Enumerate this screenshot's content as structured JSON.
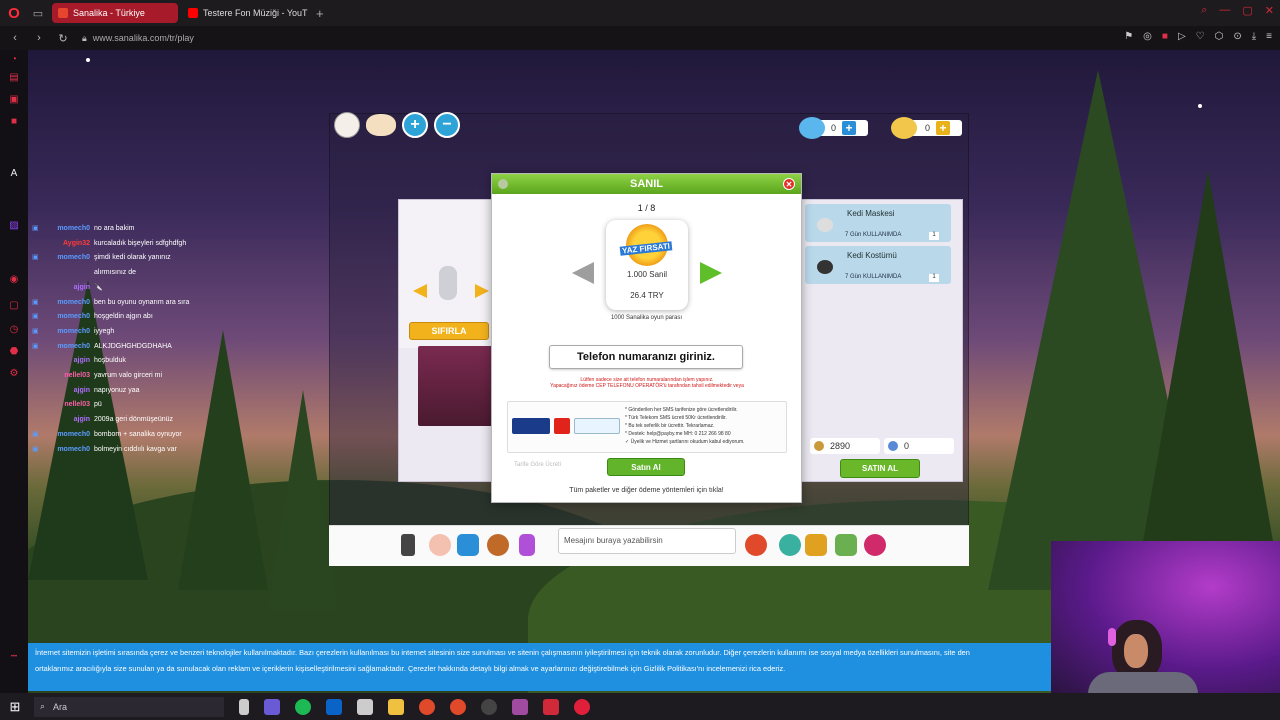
{
  "browser": {
    "tabs": [
      {
        "title": "Sanalika - Türkiye",
        "active": true,
        "color": "#e8452e"
      },
      {
        "title": "Testere Fon Müziği - YouT",
        "active": false,
        "color": "#ff0000"
      }
    ],
    "url": "www.sanalika.com/tr/play",
    "accent": "#a61a2a"
  },
  "game": {
    "hud": {
      "diamonds": "0",
      "coins": "0"
    },
    "shop": {
      "reset_label": "SIFIRLA",
      "items": [
        {
          "name": "Kedi Maskesi",
          "usage": "7 Gün KULLANIMDA",
          "count": "1"
        },
        {
          "name": "Kedi Kostümü",
          "usage": "7 Gün KULLANIMDA",
          "count": "1"
        }
      ],
      "balance_coins": "2890",
      "balance_diamonds": "0",
      "buy_label": "SATIN AL"
    },
    "modal": {
      "title": "SANIL",
      "pager": "1 / 8",
      "package_badge": "YAZ FIRSATI",
      "package_amount": "1.000 Sanil",
      "package_price": "26.4 TRY",
      "package_desc": "1000 Sanalika oyun parası",
      "phone_prompt": "Telefon numaranızı giriniz.",
      "warning_line1": "Lütfen sadece size ait telefon numaralarından işlem yapınız.",
      "warning_line2": "Yapacağınız ödeme CEP TELEFONU OPERATÖR'ü tarafından tahsil edilmektedir veya",
      "info_lines": [
        "* Gönderilen her SMS tarifenize göre ücretlendirilir.",
        "* Türk Telekom SMS ücreti 50Kr ücretlendirilir.",
        "* Bu tek seferlik bir ücrettir. Tekrarlamaz.",
        "* Destek: help@payby.me MH: 0 212 266 98 80",
        "✓ Üyelik ve Hizmet şartlarını okudum kabul ediyorum."
      ],
      "buy_label": "Satın Al",
      "faint_label": "Tarife Göre Ücreti",
      "all_packages": "Tüm paketler ve diğer ödeme yöntemleri için  tıkla!"
    },
    "chat_placeholder": "Mesajını buraya yazabilirsin"
  },
  "chat": [
    {
      "user": "momech0",
      "text": "no ara bakim",
      "color": "#5b9bff",
      "tw": true
    },
    {
      "user": "Aygin32",
      "text": "kurcaladık bişeyleri sdfghdfgh",
      "color": "#ff3b3b",
      "tw": false
    },
    {
      "user": "momech0",
      "text": "şimdi kedi olarak yanınız",
      "color": "#5b9bff",
      "tw": true
    },
    {
      "user": "",
      "text": "alırmısınız de",
      "color": "#5b9bff",
      "tw": false
    },
    {
      "user": "ajgin",
      "text": "🔪",
      "color": "#b06cff",
      "tw": false
    },
    {
      "user": "momech0",
      "text": "ben bu oyunu oynarım ara sıra",
      "color": "#5b9bff",
      "tw": true
    },
    {
      "user": "momech0",
      "text": "hoşgeldin ajgın abı",
      "color": "#5b9bff",
      "tw": true
    },
    {
      "user": "momech0",
      "text": "iyyegh",
      "color": "#5b9bff",
      "tw": true
    },
    {
      "user": "momech0",
      "text": "ALKJDGHGHDGDHAHA",
      "color": "#5b9bff",
      "tw": true
    },
    {
      "user": "ajgin",
      "text": "hoşbulduk",
      "color": "#b06cff",
      "tw": false
    },
    {
      "user": "nellel03",
      "text": "yavrum valo girceri mi",
      "color": "#ff5ca8",
      "tw": false
    },
    {
      "user": "ajgin",
      "text": "napıyonuz yaa",
      "color": "#b06cff",
      "tw": false
    },
    {
      "user": "nellel03",
      "text": "pü",
      "color": "#ff5ca8",
      "tw": false
    },
    {
      "user": "ajgin",
      "text": "2009a geri dönmüşeünüz",
      "color": "#b06cff",
      "tw": false
    },
    {
      "user": "momech0",
      "text": "bombom + sanalika oynuyor",
      "color": "#5b9bff",
      "tw": true
    },
    {
      "user": "momech0",
      "text": "bolmeyin cıddıılı kavga var",
      "color": "#5b9bff",
      "tw": true
    }
  ],
  "cookie": {
    "line1": "İnternet sitemizin işletimi sırasında çerez ve benzeri teknolojiler kullanılmaktadır. Bazı çerezlerin kullanılması bu internet sitesinin size sunulması ve sitenin çalışmasının iyileştirilmesi için teknik olarak zorunludur. Diğer çerezlerin kullanımı ise sosyal medya özellikleri sunulmasını, site den",
    "line2": "ortaklarımız aracılığıyla size sunulan ya da sunulacak olan reklam ve içeriklerin kişiselleştirilmesini sağlamaktadır. Çerezler hakkında detaylı bilgi almak ve ayarlarınızı değiştirebilmek için Gizlilik Politikası'nı incelemenizi rica ederiz."
  },
  "taskbar": {
    "search_placeholder": "Ara"
  }
}
